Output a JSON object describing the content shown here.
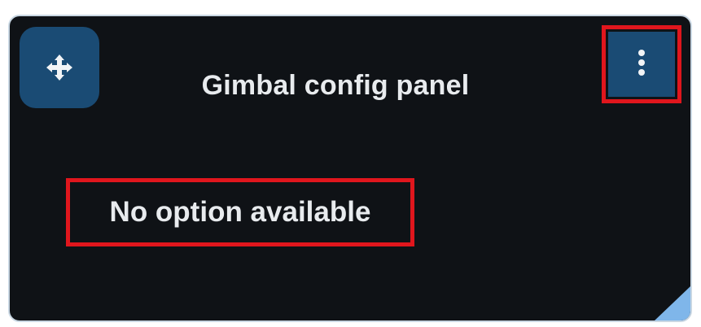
{
  "panel": {
    "title": "Gimbal config panel",
    "message": "No option available"
  },
  "icons": {
    "move": "move-arrows-icon",
    "menu": "vertical-ellipsis-icon",
    "resize": "resize-grip-icon"
  },
  "colors": {
    "panel_background": "#0f1216",
    "button_background": "#1a4b74",
    "text": "#e8ebee",
    "highlight": "#e0161d",
    "resize_grip": "#7fb6ea"
  }
}
